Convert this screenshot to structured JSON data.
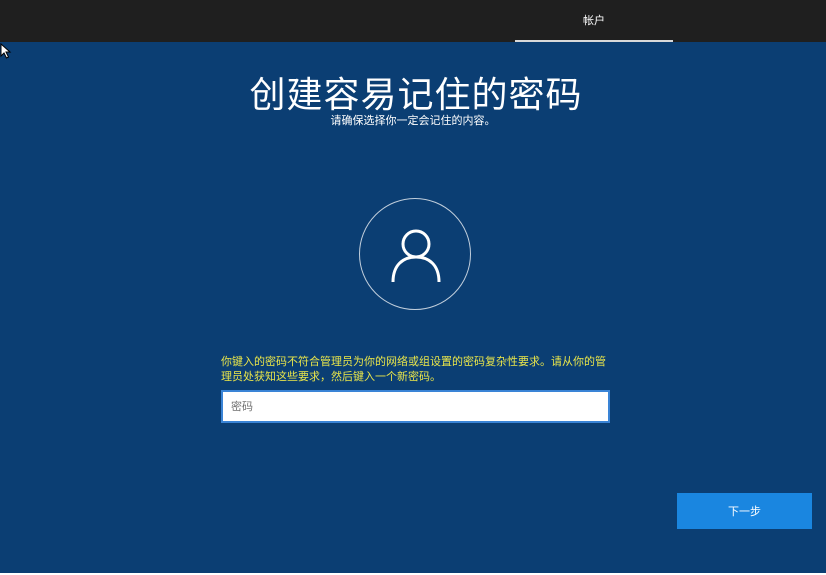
{
  "header": {
    "active_tab": "帐户"
  },
  "main": {
    "title": "创建容易记住的密码",
    "subtitle": "请确保选择你一定会记住的内容。",
    "warning": "你键入的密码不符合管理员为你的网络或组设置的密码复杂性要求。请从你的管理员处获知这些要求，然后键入一个新密码。",
    "password": {
      "placeholder": "密码",
      "value": ""
    }
  },
  "footer": {
    "next_label": "下一步"
  },
  "colors": {
    "background": "#0b3e73",
    "topbar": "#1f1f1f",
    "warning_text": "#e9e54a",
    "primary_button": "#1a86e0",
    "input_border": "#3a84d6"
  },
  "icons": {
    "avatar": "user-icon",
    "cursor": "mouse-cursor-icon"
  }
}
